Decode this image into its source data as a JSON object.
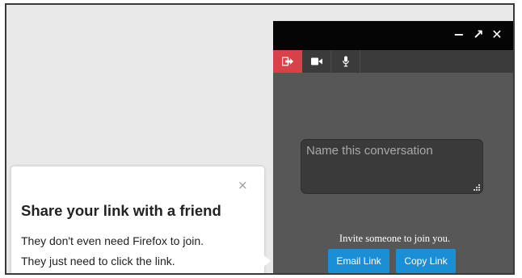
{
  "panel": {
    "window_controls": [
      {
        "icon": "minimize-icon",
        "glyph": "−"
      },
      {
        "icon": "expand-icon",
        "glyph": "↗"
      },
      {
        "icon": "close-icon",
        "glyph": "✕"
      }
    ],
    "toolbar": [
      {
        "icon": "leave-icon"
      },
      {
        "icon": "camera-icon"
      },
      {
        "icon": "microphone-icon"
      }
    ],
    "conversation_name_placeholder": "Name this conversation",
    "invite_text": "Invite someone to join you.",
    "email_link_label": "Email Link",
    "copy_link_label": "Copy Link",
    "accent_color": "#d9414a",
    "button_color": "#1a8fd6"
  },
  "tooltip": {
    "close_glyph": "×",
    "title": "Share your link with a friend",
    "line1": "They don't even need Firefox to join.",
    "line2": "They just need to click the link."
  }
}
